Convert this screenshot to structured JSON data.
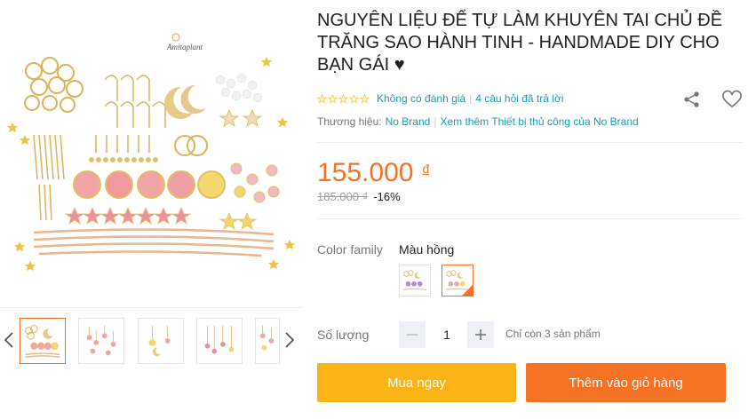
{
  "product": {
    "title": "NGUYÊN LIỆU ĐỂ TỰ LÀM KHUYÊN TAI CHỦ ĐỀ TRĂNG SAO HÀNH TINH - HANDMADE DIY CHO BẠN GÁI ♥",
    "image_logo_text": "Amitaplant"
  },
  "rating": {
    "stars": 0,
    "reviews_text": "Không có đánh giá",
    "questions_text": "4 câu hỏi đã trả lời"
  },
  "brand": {
    "label": "Thương hiệu:",
    "name": "No Brand",
    "more_text": "Xem thêm Thiết bị thủ công của No Brand"
  },
  "price": {
    "current": "155.000",
    "currency": "đ",
    "original": "185.000 ₫",
    "discount": "-16%"
  },
  "variant": {
    "label": "Color family",
    "selected": "Màu hồng"
  },
  "quantity": {
    "label": "Số lượng",
    "value": "1",
    "stock_note": "Chỉ còn 3 sản phẩm"
  },
  "actions": {
    "buy_now": "Mua ngay",
    "add_to_cart": "Thêm vào giỏ hàng"
  },
  "colors": {
    "accent": "#f57224",
    "buy": "#fcb315",
    "link": "#1a9cb7"
  },
  "icons": [
    "chevron-left-icon",
    "chevron-right-icon",
    "share-icon",
    "heart-icon",
    "minus-icon",
    "plus-icon",
    "star-icon"
  ]
}
